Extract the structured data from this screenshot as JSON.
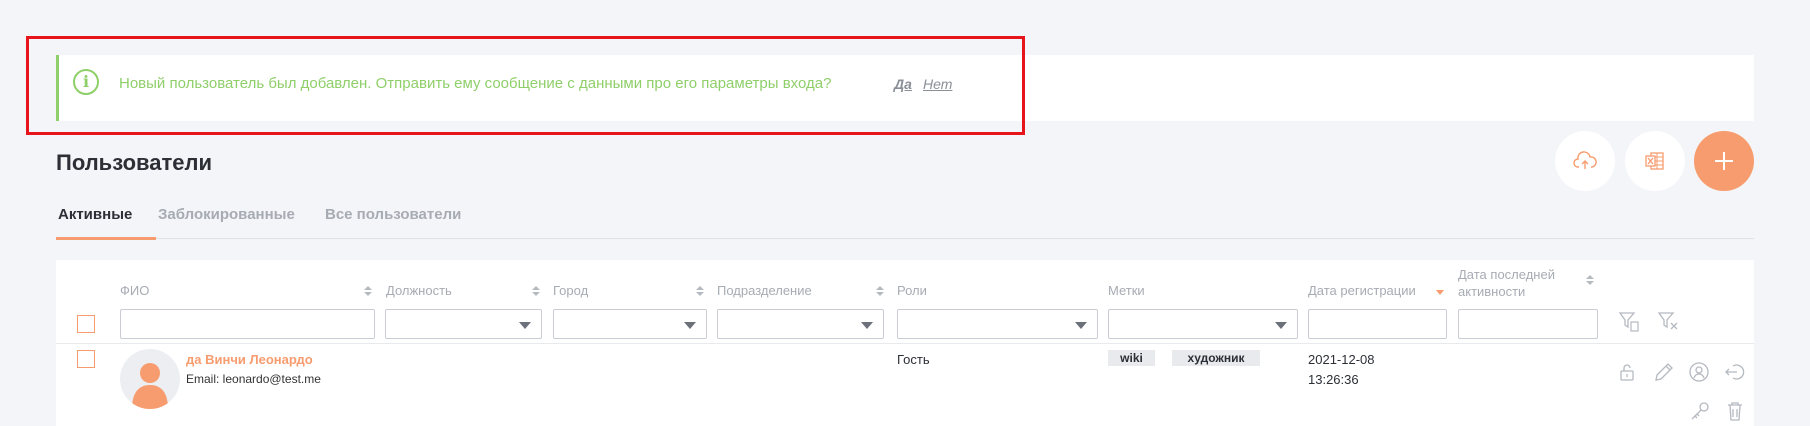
{
  "notification": {
    "message": "Новый пользователь был добавлен. Отправить ему сообщение с данными про его параметры входа?",
    "yes_label": "Да",
    "no_label": "Нет"
  },
  "page": {
    "title": "Пользователи"
  },
  "tabs": [
    {
      "label": "Активные",
      "active": true
    },
    {
      "label": "Заблокированные",
      "active": false
    },
    {
      "label": "Все пользователи",
      "active": false
    }
  ],
  "toolbar": {
    "buttons": [
      {
        "icon": "cloud-upload-icon"
      },
      {
        "icon": "excel-export-icon"
      },
      {
        "icon": "plus-icon"
      }
    ]
  },
  "table": {
    "columns": [
      {
        "label": "ФИО",
        "filter": "text"
      },
      {
        "label": "Должность",
        "filter": "select"
      },
      {
        "label": "Город",
        "filter": "select"
      },
      {
        "label": "Подразделение",
        "filter": "select"
      },
      {
        "label": "Роли",
        "filter": "select"
      },
      {
        "label": "Метки",
        "filter": "select"
      },
      {
        "label": "Дата регистрации",
        "filter": "text"
      },
      {
        "label": "Дата последней активности",
        "filter": "text"
      }
    ],
    "rows": [
      {
        "name": "да Винчи Леонардо",
        "email": "Email: leonardo@test.me",
        "position": "",
        "city": "",
        "department": "",
        "role": "Гость",
        "tags": [
          "wiki",
          "художник"
        ],
        "reg_date": "2021-12-08",
        "reg_time": "13:26:36",
        "last_activity": ""
      }
    ]
  },
  "colors": {
    "accent": "#f79c6e",
    "success": "#8fcf6a",
    "highlight": "#e8141b"
  }
}
